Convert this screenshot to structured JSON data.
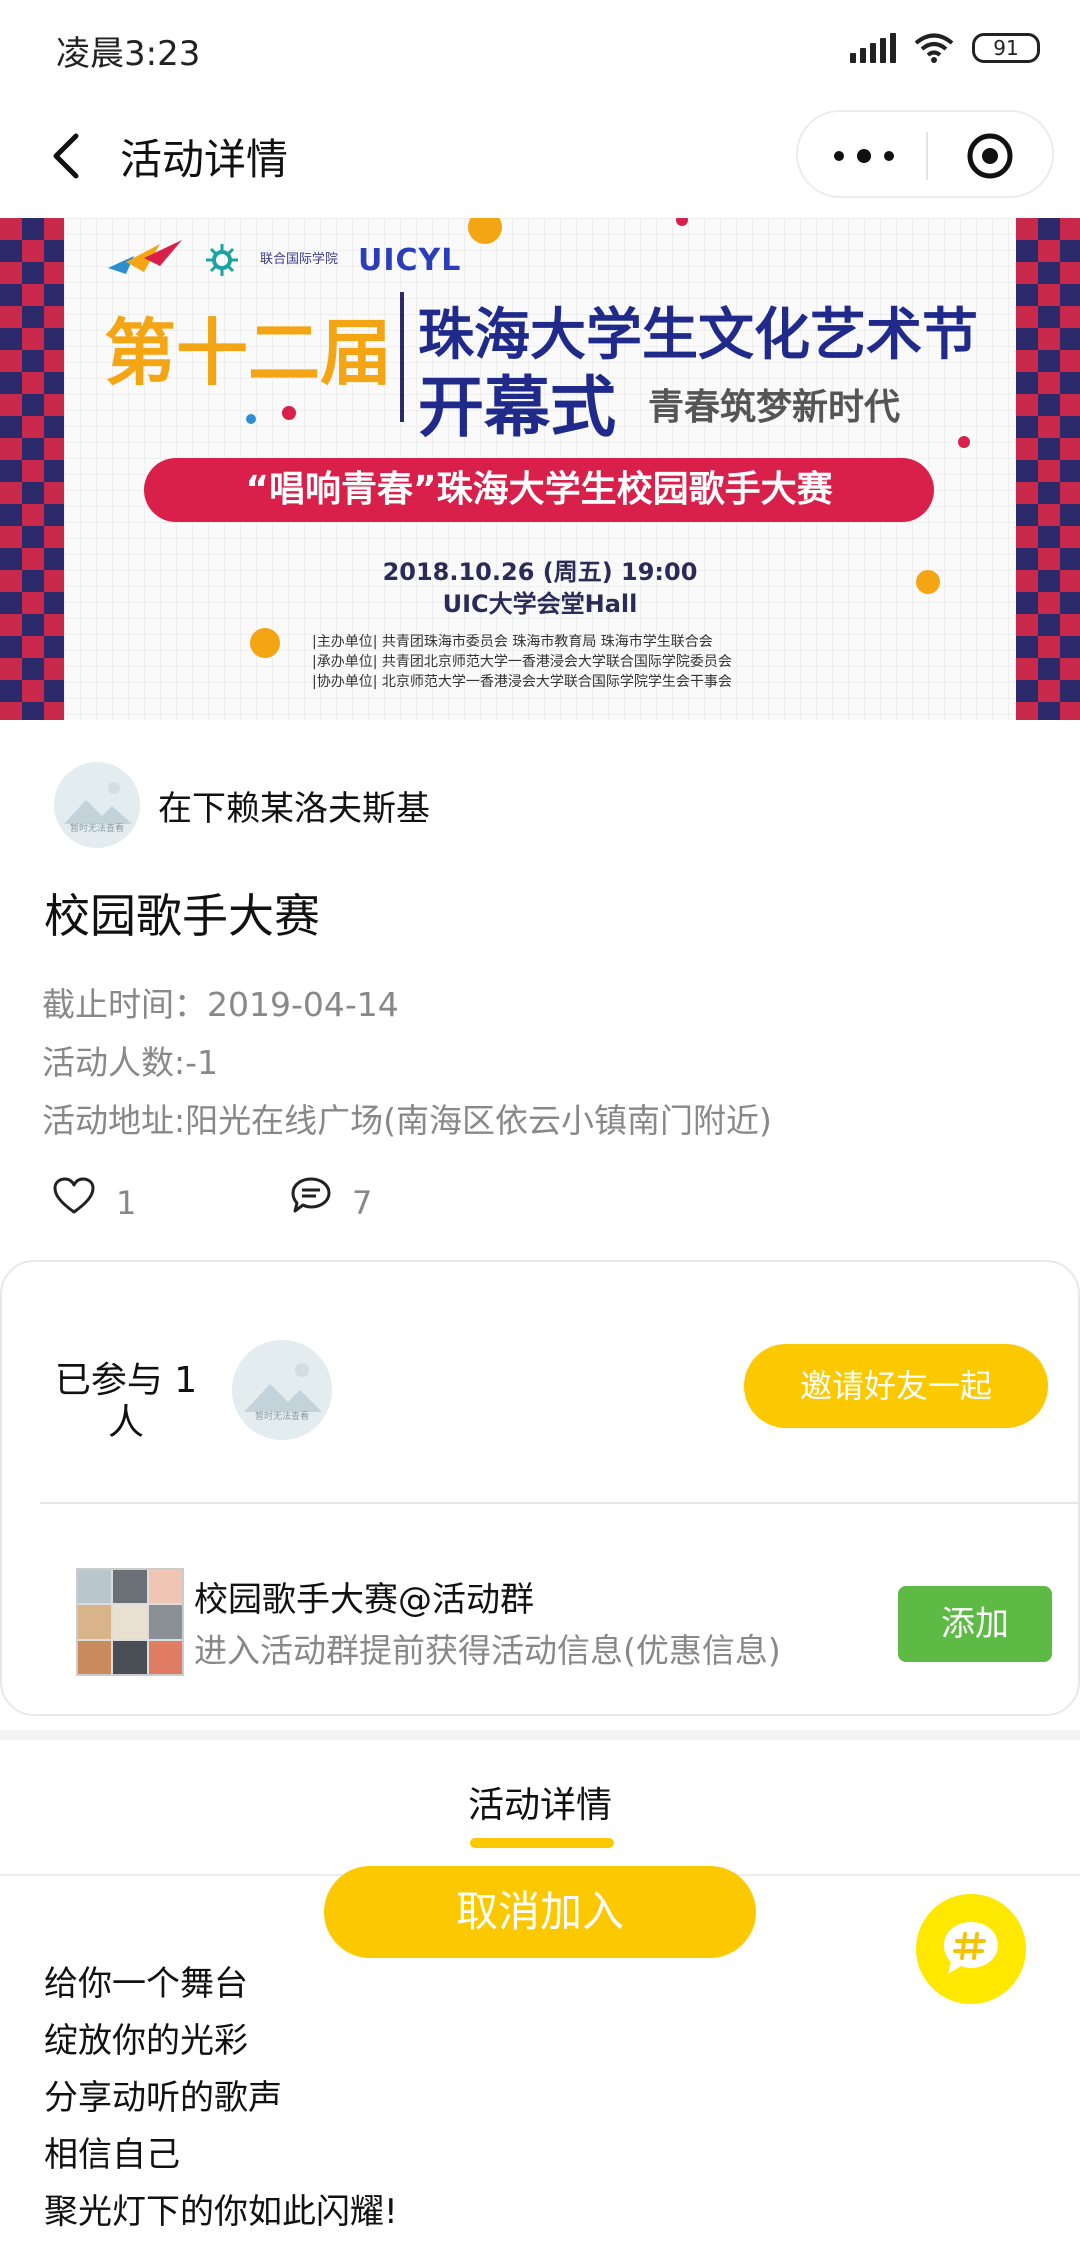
{
  "status_bar": {
    "time": "凌晨3:23",
    "battery": "91"
  },
  "nav": {
    "title": "活动详情"
  },
  "banner": {
    "logo_college": "联合国际学院",
    "logo_uicyl": "UICYL",
    "edition": "第十二届",
    "festival": "珠海大学生文化艺术节",
    "opening": "开幕式",
    "slogan": "青春筑梦新时代",
    "contest": "“唱响青春”珠海大学生校园歌手大赛",
    "datetime": "2018.10.26 (周五)   19:00",
    "venue": "UIC大学会堂Hall",
    "org_host": "|主办单位|  共青团珠海市委员会   珠海市教育局   珠海市学生联合会",
    "org_undertake": "|承办单位|  共青团北京师范大学一香港浸会大学联合国际学院委员会",
    "org_assist": "|协办单位|  北京师范大学一香港浸会大学联合国际学院学生会干事会"
  },
  "author": {
    "name": "在下赖某洛夫斯基",
    "avatar_placeholder": "暂时无法查看"
  },
  "activity": {
    "title": "校园歌手大赛",
    "deadline": "截止时间：2019-04-14",
    "count": "活动人数:-1",
    "address": "活动地址:阳光在线广场(南海区依云小镇南门附近)",
    "likes": "1",
    "comments": "7"
  },
  "participation": {
    "joined_label": "已参与 1 人",
    "invite_label": "邀请好友一起"
  },
  "group": {
    "name": "校园歌手大赛@活动群",
    "desc": "进入活动群提前获得活动信息(优惠信息)",
    "add_label": "添加"
  },
  "tabs": {
    "detail": "活动详情"
  },
  "cancel_label": "取消加入",
  "description": [
    "给你一个舞台",
    "绽放你的光彩",
    "分享动听的歌声",
    "相信自己",
    "聚光灯下的你如此闪耀!"
  ],
  "colors": {
    "accent_yellow": "#fcc800",
    "add_green": "#5dbb45",
    "banner_red": "#d8204a",
    "banner_navy": "#1f2a8a",
    "banner_orange": "#f4a514"
  },
  "icons": [
    "back-icon",
    "more-dots-icon",
    "target-icon",
    "heart-icon",
    "comment-icon",
    "chat-hash-icon"
  ]
}
